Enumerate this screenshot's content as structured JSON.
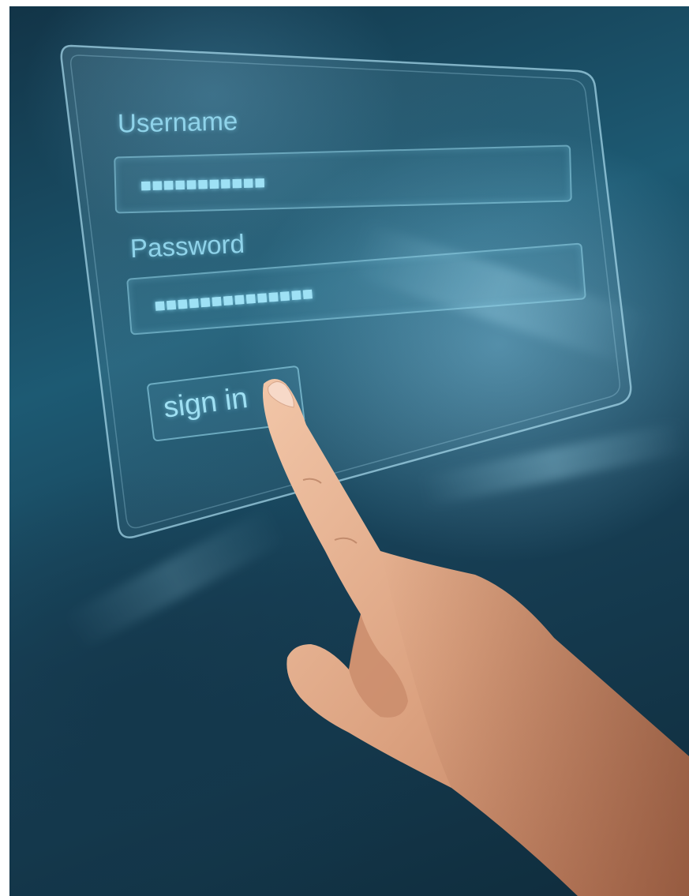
{
  "login_panel": {
    "username_label": "Username",
    "username_value": "■■■■■■■■■■■",
    "password_label": "Password",
    "password_value": "■■■■■■■■■■■■■■",
    "signin_label": "sign in"
  },
  "colors": {
    "background": "#1d5a73",
    "hologram_accent": "#8fd3ea",
    "skin": "#d9a07d"
  }
}
